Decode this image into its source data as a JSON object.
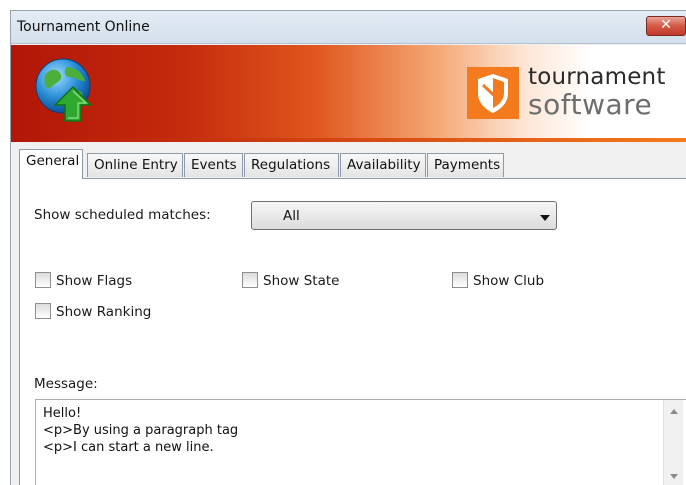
{
  "window": {
    "title": "Tournament Online",
    "close_icon": "close-x-icon",
    "close_label": "✕"
  },
  "banner": {
    "app_icon": "globe-upload-icon",
    "logo_icon": "tournament-software-shield-icon",
    "logo_line1": "tournament",
    "logo_line2": "software",
    "colors": {
      "gradient_start": "#b21608",
      "gradient_mid": "#e0561f",
      "logo_orange": "#f47a1e"
    }
  },
  "tabs": [
    {
      "label": "General",
      "active": true
    },
    {
      "label": "Online Entry",
      "active": false
    },
    {
      "label": "Events",
      "active": false
    },
    {
      "label": "Regulations",
      "active": false
    },
    {
      "label": "Availability",
      "active": false
    },
    {
      "label": "Payments",
      "active": false
    }
  ],
  "general": {
    "scheduled_label": "Show scheduled matches:",
    "scheduled_value": "All",
    "checkboxes": [
      {
        "label": "Show Flags",
        "checked": false
      },
      {
        "label": "Show State",
        "checked": false
      },
      {
        "label": "Show Club",
        "checked": false
      },
      {
        "label": "Show Ranking",
        "checked": false
      }
    ],
    "message_label": "Message:",
    "message_lines": [
      "Hello!",
      "<p>By using a paragraph tag",
      "<p>I can start a new line."
    ]
  }
}
